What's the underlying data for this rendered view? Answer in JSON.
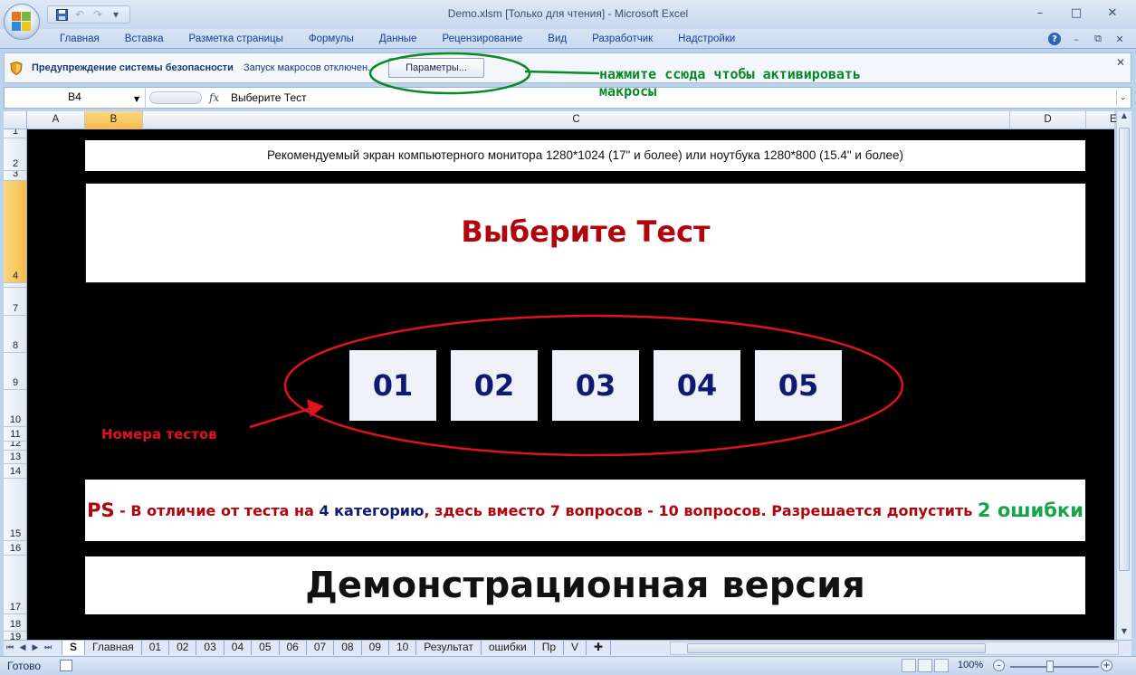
{
  "window": {
    "title": "Demo.xlsm  [Только для чтения] - Microsoft Excel",
    "minimize_glyph": "–",
    "maximize_glyph": "□",
    "close_glyph": "✕"
  },
  "qat": {
    "save_icon": "save-icon",
    "undo_glyph": "↶",
    "redo_glyph": "↷",
    "more_glyph": "▾"
  },
  "ribbon": {
    "tabs": [
      "Главная",
      "Вставка",
      "Разметка страницы",
      "Формулы",
      "Данные",
      "Рецензирование",
      "Вид",
      "Разработчик",
      "Надстройки"
    ],
    "help_glyph": "?",
    "min_glyph": "–",
    "restore_glyph": "⧉",
    "close_glyph": "✕"
  },
  "security": {
    "title": "Предупреждение системы безопасности",
    "message": "Запуск макросов отключен.",
    "options_button": "Параметры...",
    "close_glyph": "✕"
  },
  "formula_bar": {
    "name_box": "B4",
    "fx_label": "fx",
    "value": "Выберите Тест"
  },
  "grid": {
    "columns": [
      "A",
      "B",
      "C",
      "D",
      "E"
    ],
    "selected_column": "B",
    "rows": [
      "1",
      "2",
      "3",
      "4",
      "6",
      "7",
      "8",
      "9",
      "10",
      "11",
      "12",
      "13",
      "14",
      "15",
      "16",
      "17",
      "18",
      "19"
    ],
    "selected_row": "4"
  },
  "sheet": {
    "notice": "Рекомендуемый экран компьютерного монитора 1280*1024 (17\" и более) или ноутбука 1280*800 (15.4\" и более)",
    "choose_title": "Выберите Тест",
    "tests": [
      "01",
      "02",
      "03",
      "04",
      "05"
    ],
    "tests_label": "Номера тестов",
    "ps": {
      "ps_word": "PS",
      "part1": " - В отличие от теста на ",
      "num4": "4",
      "part2": " категорию",
      "part3": ", здесь вместо 7 вопросов - 10 вопросов. Разрешается допустить ",
      "errors": "2 ошибки"
    },
    "demo": "Демонстрационная версия"
  },
  "annotation": {
    "line1": "нажмите ссюда чтобы активировать",
    "line2": "макросы"
  },
  "sheet_tabs": [
    "S",
    "Главная",
    "01",
    "02",
    "03",
    "04",
    "05",
    "06",
    "07",
    "08",
    "09",
    "10",
    "Результат",
    "ошибки",
    "Пр",
    "V"
  ],
  "active_sheet": "S",
  "status": {
    "ready": "Готово",
    "zoom": "100%",
    "zoom_minus": "–",
    "zoom_plus": "+"
  },
  "colors": {
    "title_red": "#b0050c",
    "test_blue": "#0e1a72",
    "annotation_green": "#0a8a24",
    "ellipse_red": "#e1121c",
    "errors_green": "#16a34a"
  }
}
